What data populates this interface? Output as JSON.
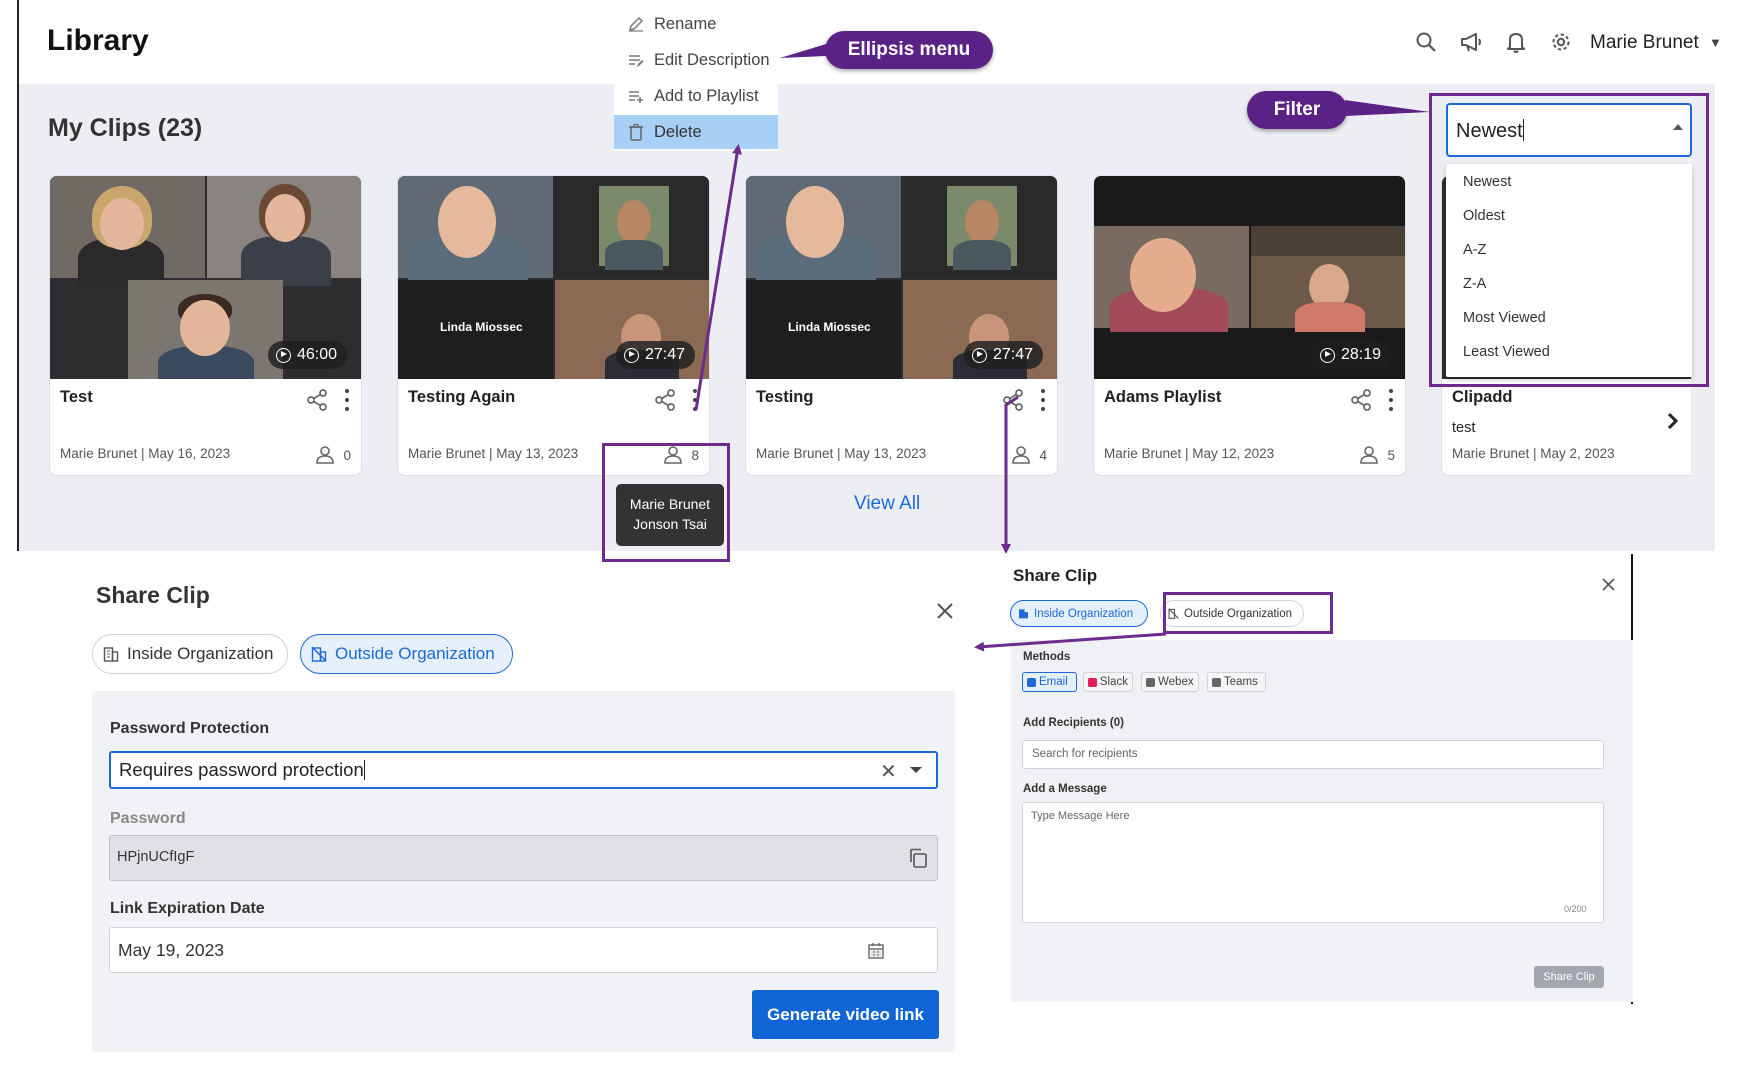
{
  "header": {
    "title": "Library",
    "user_name": "Marie Brunet",
    "icons": [
      "search-icon",
      "megaphone-icon",
      "bell-icon",
      "gear-icon"
    ]
  },
  "section": {
    "title": "My Clips (23)"
  },
  "clips": [
    {
      "title": "Test",
      "duration": "46:00",
      "author": "Marie Brunet",
      "date": "May 16, 2023",
      "meta": "Marie Brunet | May 16, 2023",
      "viewers": "0"
    },
    {
      "title": "Testing Again",
      "duration": "27:47",
      "author": "Marie Brunet",
      "date": "May 13, 2023",
      "meta": "Marie Brunet | May 13, 2023",
      "viewers": "8",
      "thumb_label": "Linda Miossec"
    },
    {
      "title": "Testing",
      "duration": "27:47",
      "author": "Marie Brunet",
      "date": "May 13, 2023",
      "meta": "Marie Brunet | May 13, 2023",
      "viewers": "4",
      "thumb_label": "Linda Miossec"
    },
    {
      "title": "Adams Playlist",
      "duration": "28:19",
      "author": "Marie Brunet",
      "date": "May 12, 2023",
      "meta": "Marie Brunet | May 12, 2023",
      "viewers": "5"
    },
    {
      "title": "Clipadd",
      "description": "test",
      "author": "Marie Brunet",
      "date": "May 2, 2023",
      "meta": "Marie Brunet | May 2, 2023"
    }
  ],
  "view_all": "View All",
  "ellipsis_menu": {
    "items": [
      {
        "label": "Rename",
        "icon": "pencil-icon"
      },
      {
        "label": "Edit Description",
        "icon": "edit-lines-icon"
      },
      {
        "label": "Add to Playlist",
        "icon": "playlist-add-icon"
      },
      {
        "label": "Delete",
        "icon": "trash-icon",
        "selected": true
      }
    ]
  },
  "callouts": {
    "ellipsis": "Ellipsis menu",
    "filter": "Filter"
  },
  "filter": {
    "value": "Newest",
    "options": [
      "Newest",
      "Oldest",
      "A-Z",
      "Z-A",
      "Most Viewed",
      "Least Viewed"
    ]
  },
  "tooltip": {
    "lines": [
      "Marie Brunet",
      "Jonson Tsai"
    ]
  },
  "share_outside": {
    "title": "Share Clip",
    "tabs": [
      "Inside Organization",
      "Outside Organization"
    ],
    "active_tab": "Outside Organization",
    "password_protection_label": "Password Protection",
    "password_protection_value": "Requires password protection",
    "password_label": "Password",
    "password_value": "HPjnUCfIgF",
    "expiration_label": "Link Expiration Date",
    "expiration_value": "May 19, 2023",
    "generate_button": "Generate video link"
  },
  "share_inside": {
    "title": "Share Clip",
    "tabs": [
      "Inside Organization",
      "Outside Organization"
    ],
    "active_tab": "Inside Organization",
    "methods_label": "Methods",
    "methods": [
      "Email",
      "Slack",
      "Webex",
      "Teams"
    ],
    "active_method": "Email",
    "recipients_label": "Add Recipients (0)",
    "recipients_placeholder": "Search for recipients",
    "message_label": "Add a Message",
    "message_placeholder": "Type Message Here",
    "message_counter": "0/200",
    "share_button": "Share Clip"
  },
  "colors": {
    "accent": "#1b6ad8",
    "callout": "#5a2287",
    "highlight_border": "#6b2b8f",
    "menu_selected": "#a8cff5",
    "library_bg": "#eceef3"
  }
}
